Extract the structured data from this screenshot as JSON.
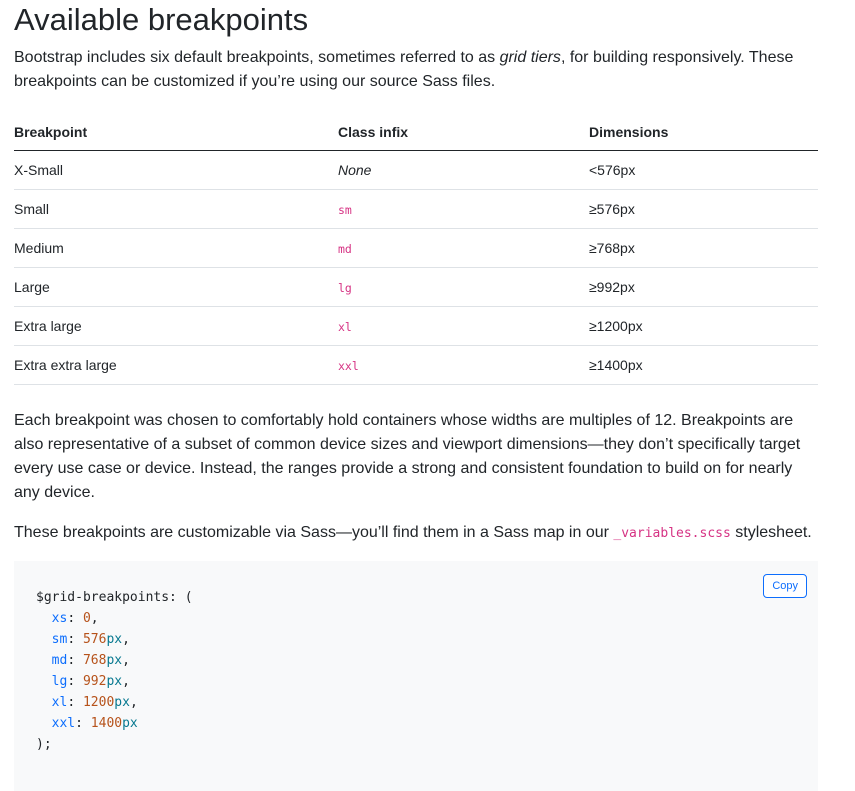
{
  "title": "Available breakpoints",
  "intro": {
    "before": "Bootstrap includes six default breakpoints, sometimes referred to as ",
    "em": "grid tiers",
    "after": ", for building responsively. These breakpoints can be customized if you’re using our source Sass files."
  },
  "table": {
    "headers": [
      "Breakpoint",
      "Class infix",
      "Dimensions"
    ],
    "rows": [
      {
        "name": "X-Small",
        "infix": "None",
        "dim": "<576px"
      },
      {
        "name": "Small",
        "infix": "sm",
        "dim": "≥576px"
      },
      {
        "name": "Medium",
        "infix": "md",
        "dim": "≥768px"
      },
      {
        "name": "Large",
        "infix": "lg",
        "dim": "≥992px"
      },
      {
        "name": "Extra large",
        "infix": "xl",
        "dim": "≥1200px"
      },
      {
        "name": "Extra extra large",
        "infix": "xxl",
        "dim": "≥1400px"
      }
    ]
  },
  "para2": "Each breakpoint was chosen to comfortably hold containers whose widths are multiples of 12. Breakpoints are also representative of a subset of common device sizes and viewport dimensions—they don’t specifically target every use case or device. Instead, the ranges provide a strong and consistent foundation to build on for nearly any device.",
  "para3": {
    "before": "These breakpoints are customizable via Sass—you’ll find them in a Sass map in our ",
    "code": "_variables.scss",
    "after": " stylesheet."
  },
  "code": {
    "copy_label": "Copy",
    "open": "$grid-breakpoints: (",
    "entries": [
      {
        "key": "xs",
        "num": "0",
        "unit": "",
        "end": ","
      },
      {
        "key": "sm",
        "num": "576",
        "unit": "px",
        "end": ","
      },
      {
        "key": "md",
        "num": "768",
        "unit": "px",
        "end": ","
      },
      {
        "key": "lg",
        "num": "992",
        "unit": "px",
        "end": ","
      },
      {
        "key": "xl",
        "num": "1200",
        "unit": "px",
        "end": ","
      },
      {
        "key": "xxl",
        "num": "1400",
        "unit": "px",
        "end": ""
      }
    ],
    "close": ");"
  }
}
